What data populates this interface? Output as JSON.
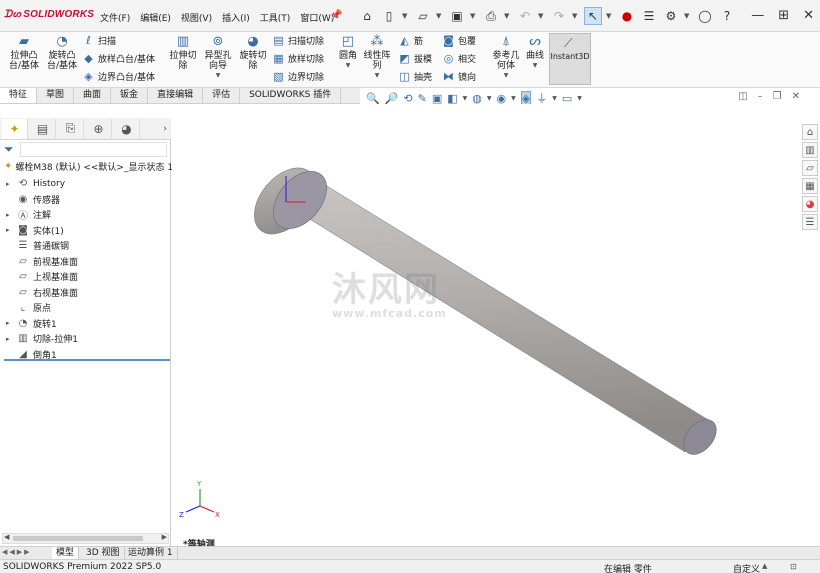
{
  "app": {
    "brand": "SOLIDWORKS",
    "menu": [
      "文件(F)",
      "编辑(E)",
      "视图(V)",
      "插入(I)",
      "工具(T)",
      "窗口(W)"
    ]
  },
  "command_manager": {
    "big_buttons": [
      {
        "label": "拉伸凸\n台/基体",
        "icon": "extrude-boss-icon"
      },
      {
        "label": "旋转凸\n台/基体",
        "icon": "revolve-boss-icon"
      },
      {
        "label": "拉伸切\n除",
        "icon": "extrude-cut-icon"
      },
      {
        "label": "异型孔\n向导",
        "icon": "hole-wizard-icon"
      },
      {
        "label": "旋转切\n除",
        "icon": "revolve-cut-icon"
      },
      {
        "label": "圆角",
        "icon": "fillet-icon"
      },
      {
        "label": "线性阵\n列",
        "icon": "linear-pattern-icon"
      },
      {
        "label": "参考几\n何体",
        "icon": "reference-geometry-icon"
      },
      {
        "label": "曲线",
        "icon": "curves-icon"
      },
      {
        "label": "Instant3D",
        "icon": "instant3d-icon"
      }
    ],
    "boss_small": [
      "扫描",
      "放样凸台/基体",
      "边界凸台/基体"
    ],
    "cut_small": [
      "扫描切除",
      "放样切除",
      "边界切除"
    ],
    "feature_small": [
      "筋",
      "拔模",
      "抽壳"
    ],
    "feature_small2": [
      "包覆",
      "相交",
      "镜向"
    ]
  },
  "tabs": [
    "特征",
    "草图",
    "曲面",
    "钣金",
    "直接编辑",
    "评估",
    "SOLIDWORKS 插件"
  ],
  "feature_tree": {
    "root": "螺栓M38 (默认) <<默认>_显示状态 1>",
    "items": [
      {
        "label": "History",
        "expandable": true,
        "icon": "history-icon"
      },
      {
        "label": "传感器",
        "expandable": false,
        "icon": "sensor-icon"
      },
      {
        "label": "注解",
        "expandable": true,
        "icon": "annotation-icon"
      },
      {
        "label": "实体(1)",
        "expandable": true,
        "icon": "solid-bodies-icon"
      },
      {
        "label": "普通碳钢",
        "expandable": false,
        "icon": "material-icon"
      },
      {
        "label": "前视基准面",
        "expandable": false,
        "icon": "plane-icon"
      },
      {
        "label": "上视基准面",
        "expandable": false,
        "icon": "plane-icon"
      },
      {
        "label": "右视基准面",
        "expandable": false,
        "icon": "plane-icon"
      },
      {
        "label": "原点",
        "expandable": false,
        "icon": "origin-icon"
      },
      {
        "label": "旋转1",
        "expandable": true,
        "icon": "revolve-feature-icon"
      },
      {
        "label": "切除-拉伸1",
        "expandable": true,
        "icon": "cut-extrude-feature-icon"
      },
      {
        "label": "倒角1",
        "expandable": false,
        "icon": "chamfer-feature-icon"
      }
    ]
  },
  "viewport": {
    "view_label": "*等轴测",
    "watermark": "沐风网",
    "watermark_url": "www.mfcad.com",
    "triad": {
      "x": "X",
      "y": "Y",
      "z": "Z"
    }
  },
  "bottom_tabs": [
    "模型",
    "3D 视图",
    "运动算例 1"
  ],
  "status": {
    "product": "SOLIDWORKS Premium 2022 SP5.0",
    "mode": "在编辑 零件",
    "units": "自定义"
  },
  "colors": {
    "brand": "#c8102e",
    "accent": "#3a6ea5",
    "part": "#b9b5b3"
  }
}
